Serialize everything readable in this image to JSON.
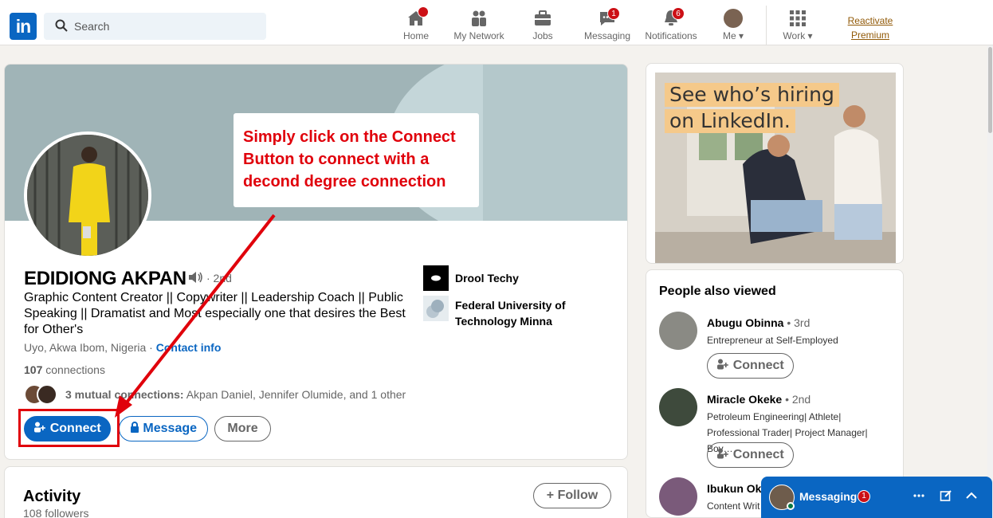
{
  "nav": {
    "logo": "in",
    "search_placeholder": "Search",
    "items": [
      {
        "label": "Home",
        "badge": ""
      },
      {
        "label": "My Network",
        "badge": ""
      },
      {
        "label": "Jobs",
        "badge": ""
      },
      {
        "label": "Messaging",
        "badge": "1"
      },
      {
        "label": "Notifications",
        "badge": "6"
      },
      {
        "label": "Me"
      },
      {
        "label": "Work"
      }
    ],
    "reactivate": "Reactivate Premium"
  },
  "profile": {
    "name": "EDIDIONG AKPAN",
    "degree": "· 2nd",
    "headline": "Graphic Content Creator || Copywriter || Leadership Coach || Public Speaking || Dramatist and Most especially one that desires the Best for Other's",
    "location": "Uyo, Akwa Ibom, Nigeria ·",
    "contact_info": "Contact info",
    "connections_count": "107",
    "connections_label": "connections",
    "mutual_bold": "3 mutual connections:",
    "mutual_names": "Akpan Daniel, Jennifer Olumide, and 1 other",
    "companies": [
      {
        "name": "Drool Techy"
      },
      {
        "name": "Federal University of Technology Minna"
      }
    ],
    "buttons": {
      "connect": "Connect",
      "message": "Message",
      "more": "More"
    }
  },
  "callout": {
    "text": "Simply click on the Connect Button to connect with a decond degree connection"
  },
  "activity": {
    "title": "Activity",
    "followers": "108 followers",
    "follow_button": "Follow"
  },
  "ad": {
    "line1": "See who’s hiring",
    "line2": "on LinkedIn."
  },
  "people_also_viewed": {
    "title": "People also viewed",
    "people": [
      {
        "name": "Abugu Obinna",
        "degree": "• 3rd",
        "desc": "Entrepreneur at Self-Employed",
        "button": "Connect"
      },
      {
        "name": "Miracle Okeke",
        "degree": "• 2nd",
        "desc": "Petroleum Engineering| Athlete| Professional Trader| Project Manager| Boy…",
        "button": "Connect"
      },
      {
        "name": "Ibukun Oke",
        "degree": "",
        "desc": "Content Writ",
        "button": ""
      }
    ]
  },
  "messaging": {
    "label": "Messaging",
    "badge": "1"
  },
  "colors": {
    "brand": "#0a66c2",
    "annotation": "#e0000b",
    "badge": "#cc1016"
  }
}
